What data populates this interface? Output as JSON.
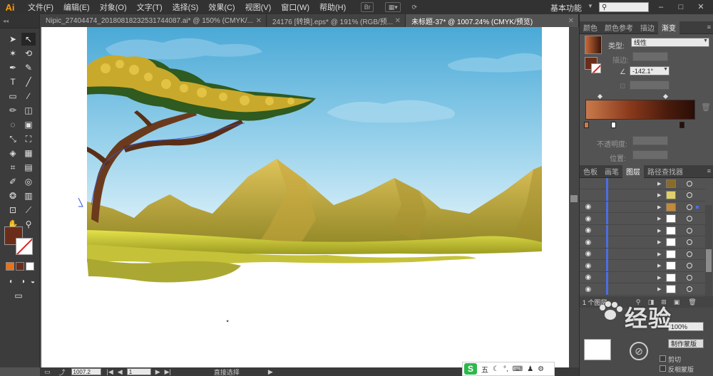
{
  "app": {
    "logo": "Ai",
    "workspace": "基本功能",
    "search_placeholder": ""
  },
  "menu": [
    "文件(F)",
    "编辑(E)",
    "对象(O)",
    "文字(T)",
    "选择(S)",
    "效果(C)",
    "视图(V)",
    "窗口(W)",
    "帮助(H)"
  ],
  "menubar_icons": {
    "br": "Br",
    "arrange": "arrange-icon",
    "sync": "sync-icon"
  },
  "window_controls": {
    "minimize": "–",
    "maximize": "□",
    "close": "✕"
  },
  "doc_tabs": [
    {
      "label": "Nipic_27404474_20180818232531744087.ai* @ 150% (CMYK/...",
      "close": "✕",
      "active": false
    },
    {
      "label": "24176 [转换].eps* @ 191% (RGB/预...",
      "close": "✕",
      "active": false
    },
    {
      "label": "未标题-37* @ 1007.24% (CMYK/预览)",
      "close": "✕",
      "active": true
    }
  ],
  "toolbar": {
    "grip": "◂◂",
    "tools": [
      "▲",
      "↖",
      "✶",
      "⟲",
      "✒",
      "✎",
      "T",
      "╱",
      "▭",
      "∕",
      "✏",
      "◫",
      "◌",
      "▣",
      "⤡",
      "⛶",
      "◈",
      "▦",
      "▤",
      "▧",
      "⌗",
      "◎",
      "⚲",
      "⌕",
      "▥",
      "▦",
      "✋",
      "🔍"
    ]
  },
  "gradient_panel": {
    "tabs": [
      "颜色",
      "颜色参考",
      "描边",
      "渐变"
    ],
    "type_label": "类型:",
    "type_value": "线性",
    "stroke_label": "描边:",
    "angle_value": "-142.1°",
    "opacity_label": "不透明度:",
    "location_label": "位置:"
  },
  "layers_panel": {
    "tabs": [
      "色板",
      "画笔",
      "图层",
      "路径查找器"
    ],
    "rows": 10,
    "footer_count": "1 个图层"
  },
  "transparency_panel": {
    "percent": "100%",
    "make_mask": "制作蒙版",
    "clip": "剪切",
    "invert_mask": "反相蒙版"
  },
  "statusbar": {
    "zoom": "1007.2",
    "page": "1",
    "tool_name": "直接选择"
  },
  "watermark": "经验",
  "ime": {
    "mode": "五",
    "icons": [
      "moon",
      "punctuation",
      "keyboard",
      "skin",
      "settings"
    ]
  },
  "colors": {
    "accent_fill": "#6b2d19",
    "gradient_start": "#c97a4c",
    "gradient_end": "#2a0e06",
    "layer_color": "#4b6ee6",
    "sky_top": "#5cb4dc",
    "sky_bottom": "#dcf0f8",
    "mountain": "#b9a636",
    "grass": "#d3d23e"
  }
}
